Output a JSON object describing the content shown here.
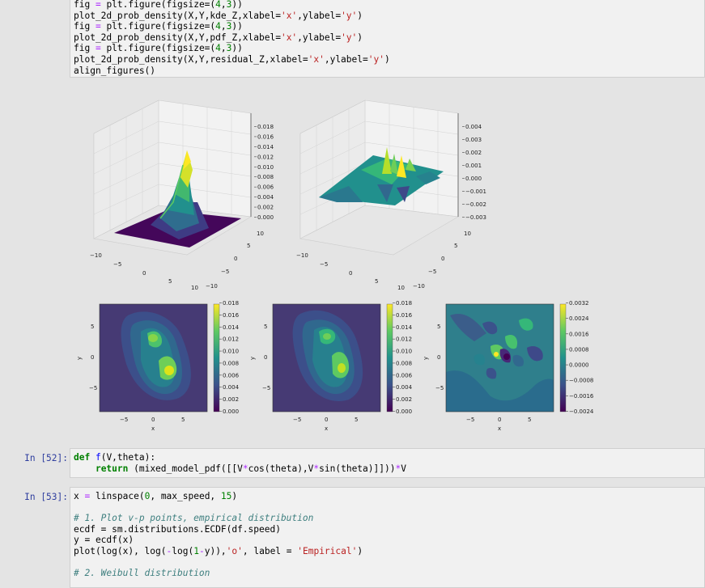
{
  "cell_top": {
    "lines": [
      "fig = plt.figure(figsize=(4,3))",
      "plot_2d_prob_density(X,Y,kde_Z,xlabel='x',ylabel='y')",
      "fig = plt.figure(figsize=(4,3))",
      "plot_2d_prob_density(X,Y,pdf_Z,xlabel='x',ylabel='y')",
      "fig = plt.figure(figsize=(4,3))",
      "plot_2d_prob_density(X,Y,residual_Z,xlabel='x',ylabel='y')",
      "align_figures()"
    ]
  },
  "plots3d": [
    {
      "z_ticks": [
        "0.018",
        "0.016",
        "0.014",
        "0.012",
        "0.010",
        "0.008",
        "0.006",
        "0.004",
        "0.002",
        "0.000"
      ],
      "x_ticks": [
        "−10",
        "−5",
        "0",
        "5",
        "10"
      ],
      "y_ticks": [
        "10",
        "5",
        "0",
        "−5",
        "−10"
      ]
    },
    {
      "z_ticks": [
        "0.004",
        "0.003",
        "0.002",
        "0.001",
        "0.000",
        "−0.001",
        "−0.002",
        "−0.003"
      ],
      "x_ticks": [
        "−10",
        "−5",
        "0",
        "5",
        "10"
      ],
      "y_ticks": [
        "10",
        "5",
        "0",
        "−5",
        "−10"
      ]
    }
  ],
  "contours": [
    {
      "xlabel": "x",
      "ylabel": "y",
      "x_ticks": [
        "−5",
        "0",
        "5"
      ],
      "y_ticks": [
        "5",
        "0",
        "−5"
      ],
      "cbar": [
        "0.018",
        "0.016",
        "0.014",
        "0.012",
        "0.010",
        "0.008",
        "0.006",
        "0.004",
        "0.002",
        "0.000"
      ]
    },
    {
      "xlabel": "x",
      "ylabel": "y",
      "x_ticks": [
        "−5",
        "0",
        "5"
      ],
      "y_ticks": [
        "5",
        "0",
        "−5"
      ],
      "cbar": [
        "0.018",
        "0.016",
        "0.014",
        "0.012",
        "0.010",
        "0.008",
        "0.006",
        "0.004",
        "0.002",
        "0.000"
      ]
    },
    {
      "xlabel": "x",
      "ylabel": "y",
      "x_ticks": [
        "−5",
        "0",
        "5"
      ],
      "y_ticks": [
        "5",
        "0",
        "−5"
      ],
      "cbar": [
        "0.0032",
        "0.0024",
        "0.0016",
        "0.0008",
        "0.0000",
        "−0.0008",
        "−0.0016",
        "−0.0024"
      ]
    }
  ],
  "cell52": {
    "prompt": "In [52]:",
    "line1_def": "def ",
    "line1_fn": "f",
    "line1_rest": "(V,theta):",
    "line2_indent": "    ",
    "line2_kw": "return",
    "line2_a": " (mixed_model_pdf([[V",
    "line2_op1": "*",
    "line2_b": "cos(theta),V",
    "line2_op2": "*",
    "line2_c": "sin(theta)]]))",
    "line2_op3": "*",
    "line2_d": "V"
  },
  "cell53": {
    "prompt": "In [53]:",
    "l1a": "x ",
    "l1op": "=",
    "l1b": " linspace(",
    "l1n0": "0",
    "l1c": ", max_speed, ",
    "l1n15": "15",
    "l1d": ")",
    "comment1": "# 1. Plot v-p points, empirical distribution",
    "l3": "ecdf = sm.distributions.ECDF(df.speed)",
    "l4": "y = ecdf(x)",
    "l5a": "plot(log(x), log(",
    "l5op": "-",
    "l5b": "log(",
    "l5n": "1",
    "l5op2": "-",
    "l5c": "y)),",
    "l5s1": "'o'",
    "l5d": ", label = ",
    "l5s2": "'Empirical'",
    "l5e": ")",
    "comment2": "# 2. Weibull distribution"
  }
}
